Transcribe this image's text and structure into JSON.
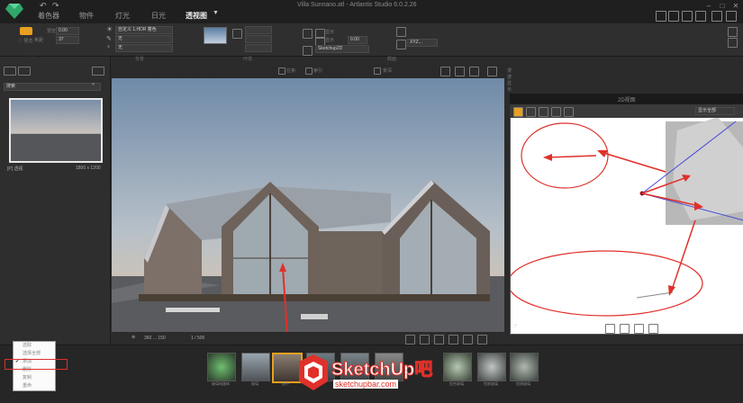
{
  "app": {
    "window_title": "Villa Sunnano.atl - Artlantis Studio 6.0.2.26",
    "menu_tabs": [
      {
        "label": "着色器",
        "active": false
      },
      {
        "label": "物件",
        "active": false
      },
      {
        "label": "灯光",
        "active": false
      },
      {
        "label": "日光",
        "active": false
      },
      {
        "label": "透视图",
        "active": true
      }
    ]
  },
  "toolbar": {
    "fields": {
      "preview_value": "0.00",
      "focal_value": "37",
      "f1": "自定义 1.HDR 着色",
      "f2": "无",
      "f3": "无",
      "checkbox_a": "显示",
      "checkbox_b": "显示",
      "value_b": "0.00",
      "sketch_preset": "Sketchup2D",
      "xyz_button": "XYZ..."
    },
    "section_labels": [
      "渲染",
      "背景",
      "环境",
      "截面"
    ]
  },
  "leftpanel": {
    "search_placeholder": "搜索",
    "item_label": "[P] 透视",
    "item_resolution": "1800 x 1200"
  },
  "viewport": {
    "top_labels": [
      "在第",
      "索引",
      "景深",
      "漫游显示"
    ],
    "bottom_label": "360 ... 150",
    "page": "1 / 500"
  },
  "view2d": {
    "title": "2D视图",
    "dropdown": "显示全部"
  },
  "context_menu": {
    "items": [
      {
        "label": "选取",
        "checked": false
      },
      {
        "label": "选择全部",
        "checked": false
      },
      {
        "label": "添加",
        "checked": true
      },
      {
        "label": "删除",
        "checked": false
      },
      {
        "label": "复制",
        "checked": false
      },
      {
        "label": "重命",
        "checked": false
      }
    ]
  },
  "thumbnails": [
    {
      "label": "玻璃电路体"
    },
    {
      "label": "玻璃"
    },
    {
      "label": "选中"
    },
    {
      "label": ""
    },
    {
      "label": ""
    },
    {
      "label": ""
    },
    {
      "label": "铝合玻璃"
    },
    {
      "label": "铝底玻璃"
    },
    {
      "label": "铝透玻璃"
    }
  ],
  "watermark": {
    "line1": "SketchUp吧",
    "line2": "sketchupbar.com"
  },
  "colors": {
    "accent": "#e8a020",
    "annotation_red": "#e0302a"
  }
}
